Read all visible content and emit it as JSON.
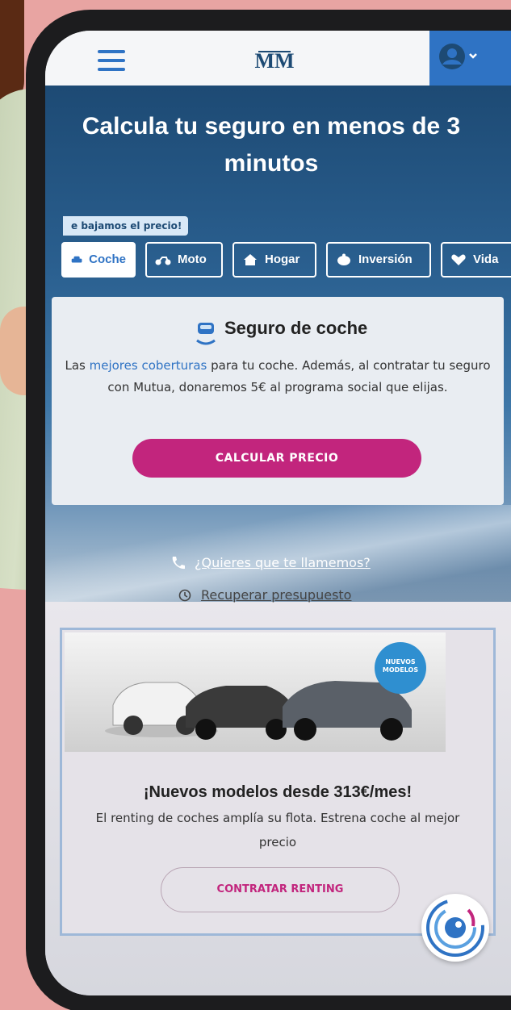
{
  "header": {
    "menu_icon": "hamburger-menu-icon",
    "logo_text": "MM",
    "user_icon": "user-account-icon",
    "accent_color": "#2f73c4"
  },
  "hero": {
    "title": "Calcula tu seguro en menos de 3 minutos",
    "promo_tag": "e bajamos el precio!",
    "tabs": [
      {
        "label": "Coche",
        "icon": "car-icon",
        "active": true
      },
      {
        "label": "Moto",
        "icon": "motorbike-icon",
        "active": false
      },
      {
        "label": "Hogar",
        "icon": "home-icon",
        "active": false
      },
      {
        "label": "Inversión",
        "icon": "piggy-bank-icon",
        "active": false
      },
      {
        "label": "Vida",
        "icon": "heart-icon",
        "active": false
      }
    ]
  },
  "insurance_card": {
    "title": "Seguro de coche",
    "text_before": "Las ",
    "text_highlight": "mejores coberturas",
    "text_after": " para tu coche. Además, al contratar tu seguro con Mutua, donaremos 5€ al programa social que elijas.",
    "button": "CALCULAR PRECIO",
    "button_color": "#c2257d"
  },
  "links": {
    "call_label": "¿Quieres que te llamemos?",
    "recover_label": "Recuperar presupuesto"
  },
  "renting_card": {
    "badge": "NUEVOS MODELOS",
    "title": "¡Nuevos modelos desde 313€/mes!",
    "text": "El renting de coches amplía su flota. Estrena coche al mejor precio",
    "button": "CONTRATAR RENTING"
  },
  "chat": {
    "icon": "chat-assistant-icon"
  }
}
